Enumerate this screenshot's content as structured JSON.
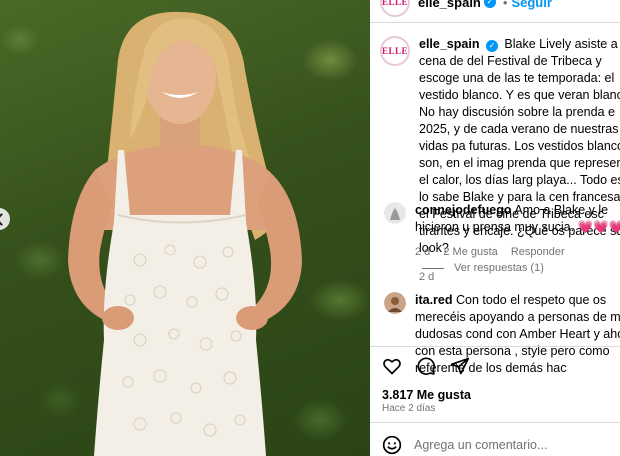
{
  "post": {
    "username": "elle_spain",
    "follow_label": "Seguir",
    "brand_logo_text": "ELLE"
  },
  "caption": {
    "username": "elle_spain",
    "text": "Blake Lively asiste a la cena de del Festival de Tribeca y escoge una de las te temporada: el vestido blanco. Y es que veran blancos. No hay discusión sobre la prenda e 2025, y de cada verano de nuestras vidas pa futuras. Los vestidos blancos son, en el imag prenda que representa el calor, los días larg playa... Todo esto lo sabe Blake y para la cen francesa en el Festival de cine de Tribeca esc tirantes y encaje. ¿Qué os parece su look?",
    "time": "2 d"
  },
  "comments": [
    {
      "username": "connejodefuego",
      "text": "Amo a Blake y le hicieron u prensa muy sucia. 💗💗💗",
      "time": "2 d",
      "likes": "2 Me gusta",
      "reply_label": "Responder",
      "view_replies": "Ver respuestas (1)"
    },
    {
      "username": "ita.red",
      "text": "Con todo el respeto que os merecéis apoyando a personas de muy dudosas cond con Amber Heart y ahora con esta persona , style pero como referente de los demás hac"
    }
  ],
  "footer": {
    "likes": "3.817 Me gusta",
    "time_ago": "Hace 2 días",
    "comment_placeholder": "Agrega un comentario..."
  },
  "colors": {
    "link_blue": "#0095f6",
    "muted": "#737373",
    "elle_pink": "#d1166f",
    "heart": "#ed4956"
  },
  "icons": [
    "verified-icon",
    "like-icon",
    "comment-icon",
    "share-icon",
    "emoji-icon",
    "chevron-left-icon"
  ]
}
